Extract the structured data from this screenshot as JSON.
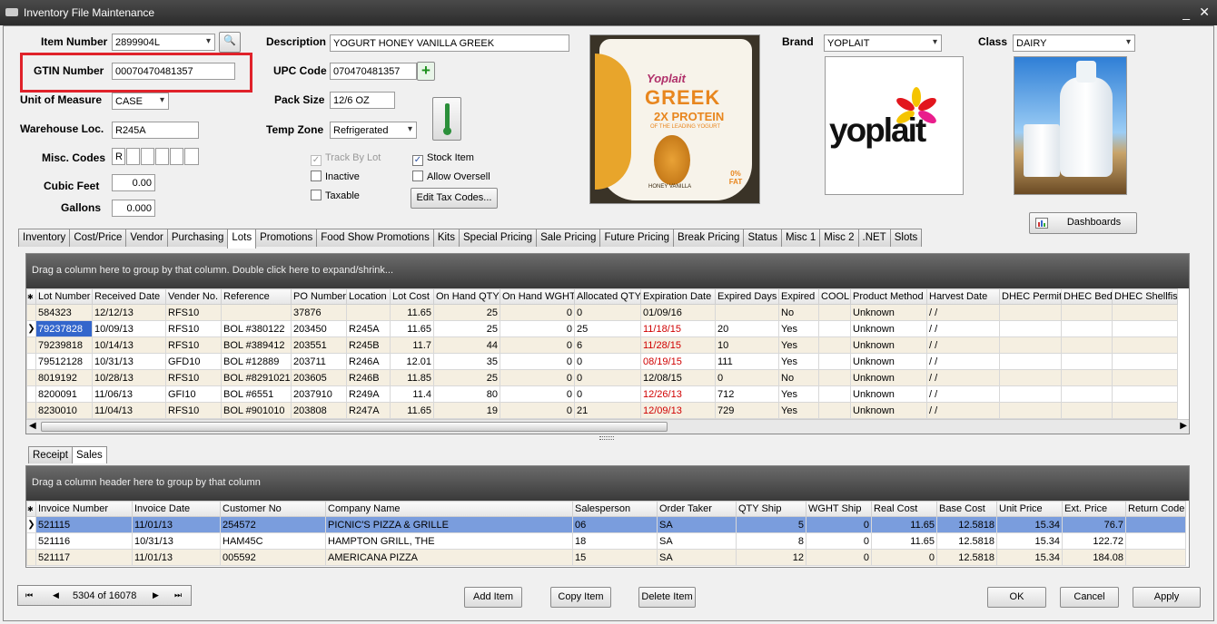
{
  "window": {
    "title": "Inventory File Maintenance",
    "min": "_",
    "close": "✕"
  },
  "form": {
    "item_number_label": "Item Number",
    "item_number": "2899904L",
    "gtin_label": "GTIN Number",
    "gtin": "00070470481357",
    "uom_label": "Unit of Measure",
    "uom": "CASE",
    "warehouse_label": "Warehouse Loc.",
    "warehouse": "R245A",
    "misc_codes_label": "Misc. Codes",
    "misc_code_1": "R",
    "cubic_label": "Cubic Feet",
    "cubic": "0.00",
    "gallons_label": "Gallons",
    "gallons": "0.000",
    "description_label": "Description",
    "description": "YOGURT HONEY VANILLA GREEK",
    "upc_label": "UPC Code",
    "upc": "070470481357",
    "pack_label": "Pack Size",
    "pack": "12/6 OZ",
    "temp_label": "Temp Zone",
    "temp": "Refrigerated",
    "brand_label": "Brand",
    "brand": "YOPLAIT",
    "class_label": "Class",
    "class": "DAIRY",
    "track_by_lot": "Track By Lot",
    "inactive": "Inactive",
    "taxable": "Taxable",
    "stock_item": "Stock Item",
    "allow_oversell": "Allow Oversell",
    "edit_tax": "Edit Tax Codes...",
    "dashboards": "Dashboards"
  },
  "product_image": {
    "brand": "Yoplait",
    "name": "GREEK",
    "sub": "2X PROTEIN",
    "sub2": "OF THE LEADING YOGURT",
    "flavor": "HONEY VANILLA",
    "fat": "0% FAT"
  },
  "brand_logo": "yoplait",
  "tabs": [
    "Inventory",
    "Cost/Price",
    "Vendor",
    "Purchasing",
    "Lots",
    "Promotions",
    "Food Show Promotions",
    "Kits",
    "Special Pricing",
    "Sale Pricing",
    "Future Pricing",
    "Break Pricing",
    "Status",
    "Misc 1",
    "Misc 2",
    ".NET",
    "Slots"
  ],
  "active_tab": "Lots",
  "lots": {
    "group_hint": "Drag a column here to group by that column. Double click here to expand/shrink...",
    "columns": [
      "Lot Number",
      "Received Date",
      "Vender No.",
      "Reference",
      "PO Number",
      "Location",
      "Lot Cost",
      "On Hand QTY",
      "On Hand WGHT",
      "Allocated QTY",
      "Expiration Date",
      "Expired Days",
      "Expired",
      "COOL",
      "Product Method",
      "Harvest Date",
      "DHEC Permit",
      "DHEC Bed",
      "DHEC Shellfish"
    ],
    "rows": [
      [
        "584323",
        "12/12/13",
        "RFS10",
        "",
        "37876",
        "",
        "11.65",
        "25",
        "0",
        "0",
        "01/09/16",
        "",
        "No",
        "",
        "Unknown",
        " / /",
        "",
        "",
        ""
      ],
      [
        "79237828",
        "10/09/13",
        "RFS10",
        "BOL #380122",
        "203450",
        "R245A",
        "11.65",
        "25",
        "0",
        "25",
        "11/18/15",
        "20",
        "Yes",
        "",
        "Unknown",
        " / /",
        "",
        "",
        ""
      ],
      [
        "79239818",
        "10/14/13",
        "RFS10",
        "BOL #389412",
        "203551",
        "R245B",
        "11.7",
        "44",
        "0",
        "6",
        "11/28/15",
        "10",
        "Yes",
        "",
        "Unknown",
        " / /",
        "",
        "",
        ""
      ],
      [
        "79512128",
        "10/31/13",
        "GFD10",
        "BOL #12889",
        "203711",
        "R246A",
        "12.01",
        "35",
        "0",
        "0",
        "08/19/15",
        "111",
        "Yes",
        "",
        "Unknown",
        " / /",
        "",
        "",
        ""
      ],
      [
        "8019192",
        "10/28/13",
        "RFS10",
        "BOL #8291021",
        "203605",
        "R246B",
        "11.85",
        "25",
        "0",
        "0",
        "12/08/15",
        "0",
        "No",
        "",
        "Unknown",
        " / /",
        "",
        "",
        ""
      ],
      [
        "8200091",
        "11/06/13",
        "GFI10",
        "BOL #6551",
        "2037910",
        "R249A",
        "11.4",
        "80",
        "0",
        "0",
        "12/26/13",
        "712",
        "Yes",
        "",
        "Unknown",
        " / /",
        "",
        "",
        ""
      ],
      [
        "8230010",
        "11/04/13",
        "RFS10",
        "BOL #901010",
        "203808",
        "R247A",
        "11.65",
        "19",
        "0",
        "21",
        "12/09/13",
        "729",
        "Yes",
        "",
        "Unknown",
        " / /",
        "",
        "",
        ""
      ]
    ]
  },
  "sub_tabs": [
    "Receipt",
    "Sales"
  ],
  "sales": {
    "group_hint": "Drag a column header here to group by that column",
    "columns": [
      "Invoice Number",
      "Invoice Date",
      "Customer No",
      "Company Name",
      "Salesperson",
      "Order Taker",
      "QTY Ship",
      "WGHT Ship",
      "Real Cost",
      "Base Cost",
      "Unit Price",
      "Ext. Price",
      "Return Code"
    ],
    "rows": [
      [
        "521115",
        "11/01/13",
        "254572",
        "PICNIC'S PIZZA & GRILLE",
        "06",
        "SA",
        "5",
        "0",
        "11.65",
        "12.5818",
        "15.34",
        "76.7",
        ""
      ],
      [
        "521116",
        "10/31/13",
        "HAM45C",
        "HAMPTON GRILL, THE",
        "18",
        "SA",
        "8",
        "0",
        "11.65",
        "12.5818",
        "15.34",
        "122.72",
        ""
      ],
      [
        "521117",
        "11/01/13",
        "005592",
        "AMERICANA PIZZA",
        "15",
        "SA",
        "12",
        "0",
        "0",
        "12.5818",
        "15.34",
        "184.08",
        ""
      ]
    ]
  },
  "nav": {
    "record": "5304 of 16078"
  },
  "buttons": {
    "add": "Add Item",
    "copy": "Copy Item",
    "delete": "Delete Item",
    "ok": "OK",
    "cancel": "Cancel",
    "apply": "Apply"
  }
}
